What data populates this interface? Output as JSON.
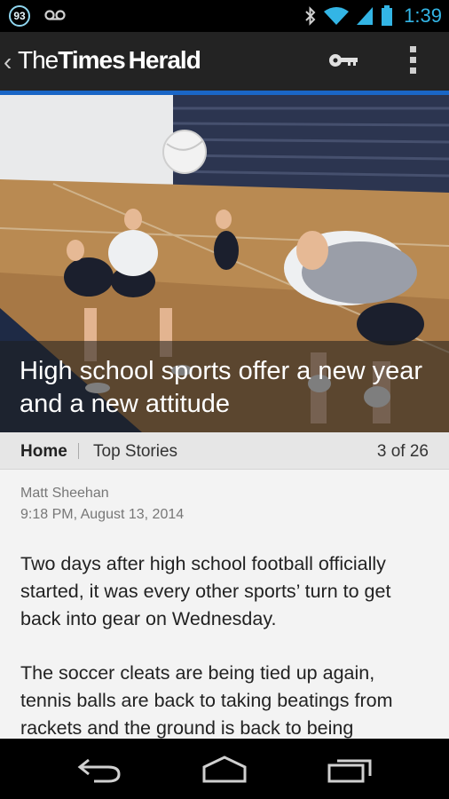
{
  "status_bar": {
    "notification_count": "93",
    "time": "1:39",
    "icons": [
      "voicemail-icon",
      "bluetooth-icon",
      "wifi-icon",
      "signal-icon",
      "battery-icon"
    ],
    "accent_color": "#33b5e5"
  },
  "app_bar": {
    "brand_the": "The",
    "brand_times": "Times",
    "brand_herald": "Herald",
    "icons": [
      "chevron-left-icon",
      "key-icon",
      "overflow-menu-icon"
    ],
    "accent_line_color": "#1a66c6"
  },
  "hero": {
    "headline": "High school sports offer a new year and a new attitude"
  },
  "section_bar": {
    "home": "Home",
    "section": "Top Stories",
    "pager": "3 of 26"
  },
  "article": {
    "author": "Matt Sheehan",
    "date": "9:18 PM, August 13, 2014",
    "paragraph_1": "Two days after high school football officially started, it was every other sports’ turn to get back into gear on Wednesday.",
    "paragraph_2": "The soccer cleats are being tied up again, tennis balls are back to taking beatings from rackets and the ground is back to being"
  },
  "nav_bar": {
    "icons": [
      "back-icon",
      "home-icon",
      "recent-apps-icon"
    ]
  }
}
